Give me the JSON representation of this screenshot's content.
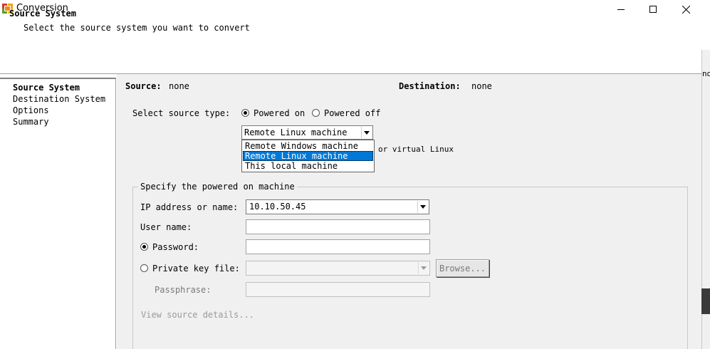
{
  "window": {
    "title": "Conversion",
    "controls": [
      "minimize-icon",
      "maximize-icon",
      "close-icon"
    ]
  },
  "header": {
    "title": "Source System",
    "subtitle": "Select the source system you want to convert"
  },
  "background_window": {
    "text": "nd"
  },
  "nav": {
    "items": [
      {
        "label": "Source System",
        "active": true
      },
      {
        "label": "Destination System",
        "active": false
      },
      {
        "label": "Options",
        "active": false
      },
      {
        "label": "Summary",
        "active": false
      }
    ]
  },
  "summary": {
    "source_label": "Source:",
    "source_value": "none",
    "destination_label": "Destination:",
    "destination_value": "none"
  },
  "source_type": {
    "label": "Select source type:",
    "powered_on": "Powered on",
    "powered_off": "Powered off",
    "selected": "Powered on",
    "machine_select_value": "Remote Linux machine",
    "dropdown_options": [
      "Remote Windows machine",
      "Remote Linux machine",
      "This local machine"
    ],
    "hint": "or virtual Linux"
  },
  "machine_group": {
    "legend": "Specify the powered on machine",
    "ip_label": "IP address or name:",
    "ip_value": "10.10.50.45",
    "user_label": "User name:",
    "user_value": "",
    "password_label": "Password:",
    "password_value": "",
    "key_label": "Private key file:",
    "browse_label": "Browse...",
    "passphrase_label": "Passphrase:",
    "details_link": "View source details...",
    "auth_selected": "Password"
  },
  "colors": {
    "selection": "#0078d7",
    "panel_bg": "#f0f0f0",
    "disabled_text": "#7a7a7a"
  }
}
